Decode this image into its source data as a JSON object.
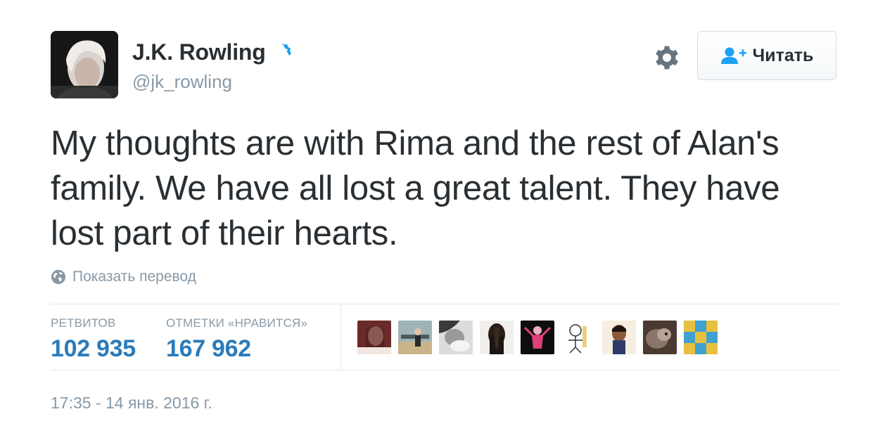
{
  "user": {
    "name": "J.K. Rowling",
    "handle": "@jk_rowling",
    "verified": true
  },
  "actions": {
    "settings_icon": "gear-icon",
    "follow_label": "Читать",
    "follow_icon": "follow-person-plus-icon"
  },
  "tweet": {
    "text": "My thoughts are with Rima and the rest of Alan's family. We have all lost a great talent. They have lost part of their hearts.",
    "translate_label": "Показать перевод",
    "translate_icon": "globe-icon"
  },
  "stats": {
    "retweets_label": "РЕТВИТОВ",
    "retweets_value": "102 935",
    "likes_label": "ОТМЕТКИ «НРАВИТСЯ»",
    "likes_value": "167 962"
  },
  "likers_count_shown": 9,
  "timestamp": "17:35 - 14 янв. 2016 г.",
  "colors": {
    "text": "#292f33",
    "muted": "#8899a6",
    "link_blue": "#2b7bb9",
    "verified_blue": "#1da1f2",
    "divider": "#e1e8ed"
  }
}
